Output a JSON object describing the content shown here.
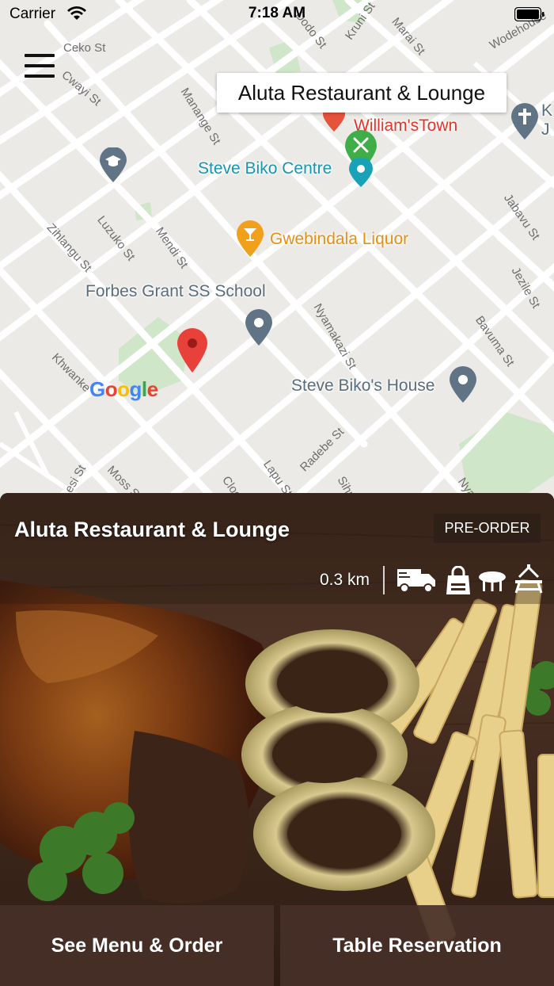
{
  "status_bar": {
    "carrier": "Carrier",
    "time": "7:18 AM"
  },
  "map": {
    "callout_title": "Aluta Restaurant & Lounge",
    "google_logo": "Google",
    "streets": [
      "Ceko St",
      "Cwayi St",
      "Manange St",
      "Dodo St",
      "Kruni St",
      "Marai St",
      "Wodehouse",
      "Luzuko St",
      "Mendi St",
      "Zihlangu St",
      "Jabavu St",
      "Jezile St",
      "Bavuma St",
      "Nyamakazi St",
      "Khwanke",
      "Radebe St",
      "Lapu St",
      "Cloete",
      "Moss St",
      "Sihu",
      "Nyam",
      "esi St"
    ],
    "pois": {
      "williamstown": "William'sTown",
      "steve_biko_centre": "Steve Biko Centre",
      "gwebindala": "Gwebindala Liquor",
      "forbes_grant": "Forbes Grant SS School",
      "biko_house": "Steve Biko's House",
      "church_partial": "K J"
    },
    "colors": {
      "red": "#e53935",
      "teal": "#17a2b8",
      "orange": "#e8900c",
      "grey_text": "#5a6d7c",
      "green": "#3fae49"
    },
    "icons": [
      "menu-icon",
      "restaurant-pin-icon",
      "school-pin-icon",
      "bar-pin-icon",
      "place-pin-icon",
      "church-pin-icon",
      "location-pin-icon"
    ]
  },
  "card": {
    "title": "Aluta Restaurant & Lounge",
    "preorder_label": "PRE-ORDER",
    "distance": "0.3 km",
    "service_icons": [
      "delivery-truck-icon",
      "takeaway-bag-icon",
      "dine-in-table-icon",
      "outdoor-picnic-icon"
    ],
    "buttons": {
      "menu": "See Menu & Order",
      "reservation": "Table Reservation"
    }
  }
}
